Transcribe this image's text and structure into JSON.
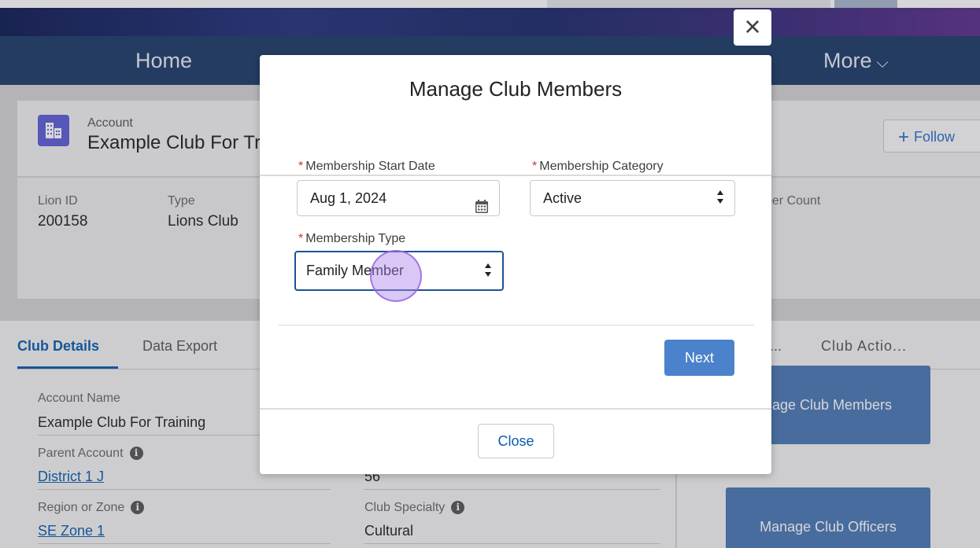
{
  "nav": {
    "home": "Home",
    "more": "More"
  },
  "account": {
    "label": "Account",
    "name": "Example Club For Training",
    "follow": "Follow"
  },
  "highlights": {
    "lion_id_label": "Lion ID",
    "lion_id": "200158",
    "type_label": "Type",
    "type": "Lions Club",
    "member_count_label": "per Count"
  },
  "tabs": {
    "details": "Club Details",
    "export": "Data Export"
  },
  "details": {
    "account_name_label": "Account Name",
    "account_name": "Example Club For Training",
    "parent_label": "Parent Account",
    "parent": "District 1 J",
    "region_label": "Region or Zone",
    "region": "SE Zone 1",
    "partial_value": "56",
    "specialty_label": "Club Specialty",
    "specialty": "Cultural"
  },
  "right_tabs": {
    "tab1": "...",
    "tab2": "Club Actio..."
  },
  "right_buttons": {
    "manage_members": "nage Club Members",
    "manage_officers": "Manage Club Officers"
  },
  "modal": {
    "title": "Manage Club Members",
    "close_x": "×",
    "start_date_label": "Membership Start Date",
    "start_date": "Aug 1, 2024",
    "category_label": "Membership Category",
    "category": "Active",
    "type_label": "Membership Type",
    "type": "Family Member",
    "required_marker": "*",
    "next": "Next",
    "close": "Close"
  }
}
